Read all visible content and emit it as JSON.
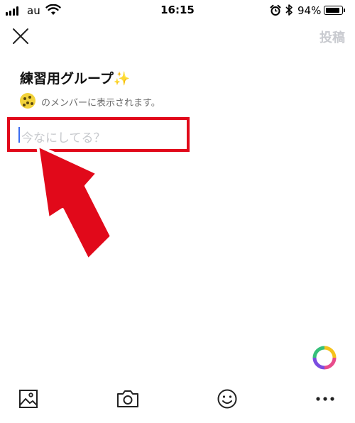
{
  "status_bar": {
    "carrier": "au",
    "time": "16:15",
    "battery_percent_label": "94%",
    "battery_level": 0.94,
    "icons": [
      "signal-icon",
      "wifi-icon",
      "alarm-icon",
      "bluetooth-icon",
      "battery-icon"
    ]
  },
  "header": {
    "close_icon": "close-icon",
    "post_label": "投稿",
    "post_enabled": false
  },
  "group": {
    "title": "練習用グループ✨",
    "visibility_text": "のメンバーに表示されます。"
  },
  "composer": {
    "value": "",
    "placeholder": "今なにしてる？"
  },
  "annotation": {
    "highlight_color": "#e1091a",
    "arrow_color": "#e1091a"
  },
  "toolbar": {
    "items": [
      "photo-icon",
      "camera-icon",
      "sticker-icon",
      "more-icon"
    ]
  },
  "colors": {
    "accent_cursor": "#3a6cf0",
    "disabled_text": "#c9cbd0",
    "placeholder_text": "#c7c9cd"
  }
}
